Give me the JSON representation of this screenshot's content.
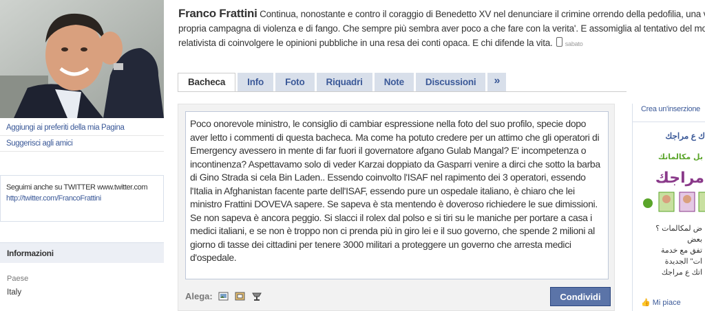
{
  "profile": {
    "name": "Franco Frattini",
    "status": "Continua, nonostante e contro il coraggio di Benedetto XV nel denunciare il crimine orrendo della pedofilia, una vera e propria campagna di violenza e di fango. Che sempre più sembra aver poco a che fare con la verita'. E assomiglia al tentativo del mondo relativista di coinvolgere le opinioni pubbliche in una resa dei conti opaca. E chi difende la vita.",
    "status_time": "sabato"
  },
  "left": {
    "links": [
      "Aggiungi ai preferiti della mia Pagina",
      "Suggerisci agli amici"
    ],
    "twitter_text": "Seguimi anche su TWITTER www.twitter.com",
    "twitter_link": "http://twitter.com/FrancoFrattini",
    "info_heading": "Informazioni",
    "info_label": "Paese",
    "info_value": "Italy"
  },
  "tabs": [
    {
      "label": "Bacheca",
      "active": true
    },
    {
      "label": "Info",
      "active": false
    },
    {
      "label": "Foto",
      "active": false
    },
    {
      "label": "Riquadri",
      "active": false
    },
    {
      "label": "Note",
      "active": false
    },
    {
      "label": "Discussioni",
      "active": false
    },
    {
      "label": "»",
      "active": false
    }
  ],
  "composer": {
    "text": "Poco onorevole ministro, le consiglio di cambiar espressione nella foto del suo profilo, specie dopo aver letto i commenti di questa bacheca. Ma come ha potuto credere per un attimo che gli operatori di Emergency avessero in mente di far fuori il governatore afgano Gulab Mangal? E' incompetenza o incontinenza? Aspettavamo solo di veder Karzai doppiato da Gasparri venire a dirci che sotto la barba di Gino Strada si cela Bin Laden.. Essendo coinvolto l'ISAF nel rapimento dei 3 operatori, essendo l'Italia in Afghanistan facente parte dell'ISAF, essendo pure un ospedale italiano, è chiaro che lei ministro Frattini DOVEVA sapere. Se sapeva è sta mentendo è doveroso richiedere le sue dimissioni. Se non sapeva è ancora peggio. Si slacci il rolex dal polso e si tiri su le maniche per portare a casa i medici italiani, e se non è troppo non ci prenda più in giro lei e il suo governo, che spende 2 milioni al giorno di tasse dei cittadini per tenere 3000 militari a proteggere un governo che arresta medici d'ospedale.",
    "attach_label": "Alega:",
    "share_label": "Condividi"
  },
  "right": {
    "create_label": "Crea un'inserzione",
    "ad_title": "ك ع مراجك",
    "ad_banner_top": "بل مكالماتك",
    "ad_banner_main": "مراجك",
    "ad_text": [
      "ض لمكالمات ؟",
      "بعض",
      "تفق مع خدمة",
      "ات\" الجديدة",
      "اتك ع مراجك"
    ],
    "like_label": "Mi piace"
  },
  "colors": {
    "link": "#3b5998",
    "tab_bg": "#d8dfea",
    "button_bg": "#5b74a8"
  }
}
